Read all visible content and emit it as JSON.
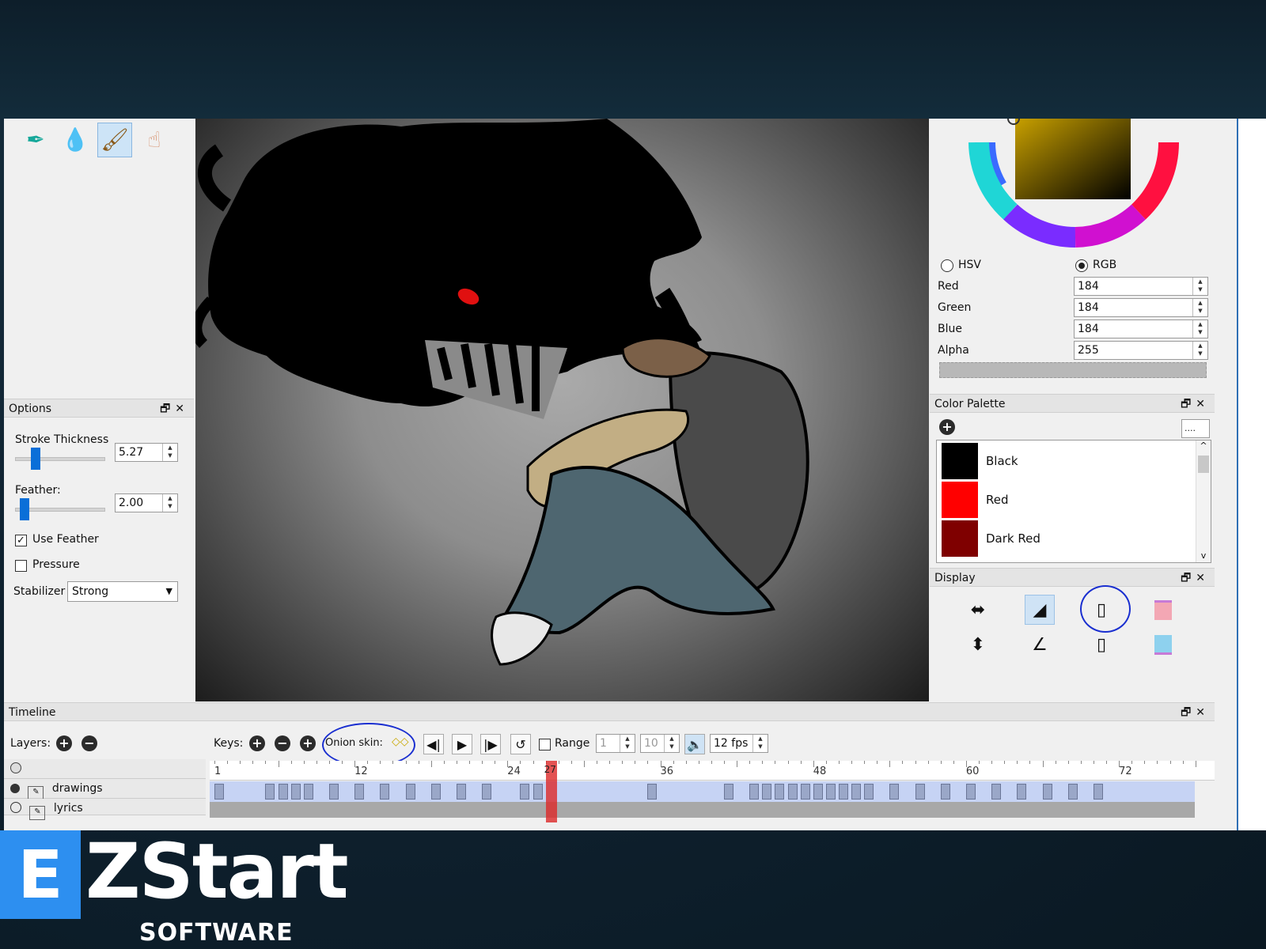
{
  "options": {
    "title": "Options",
    "stroke_label": "Stroke Thickness",
    "stroke_value": "5.27",
    "stroke_level": 0.18,
    "feather_label": "Feather:",
    "feather_value": "2.00",
    "feather_level": 0.05,
    "use_feather_label": "Use Feather",
    "use_feather_checked": true,
    "pressure_label": "Pressure",
    "pressure_checked": false,
    "stabilizer_label": "Stabilizer",
    "stabilizer_value": "Strong"
  },
  "color": {
    "hsv_label": "HSV",
    "rgb_label": "RGB",
    "mode": "RGB",
    "red_label": "Red",
    "red": "184",
    "green_label": "Green",
    "green": "184",
    "blue_label": "Blue",
    "blue": "184",
    "alpha_label": "Alpha",
    "alpha": "255",
    "preview": "#b8b8b8"
  },
  "palette": {
    "title": "Color Palette",
    "menu_label": "....",
    "items": [
      {
        "name": "Black",
        "color": "#000000"
      },
      {
        "name": "Red",
        "color": "#ff0000"
      },
      {
        "name": "Dark Red",
        "color": "#7f0000"
      }
    ]
  },
  "display": {
    "title": "Display"
  },
  "timeline": {
    "title": "Timeline",
    "layers_label": "Layers:",
    "keys_label": "Keys:",
    "onion_label": "Onion skin:",
    "range_label": "Range",
    "range_start": "1",
    "range_end": "10",
    "fps": "12 fps",
    "current_frame": "27",
    "ruler_labels": [
      "1",
      "12",
      "24",
      "36",
      "48",
      "60",
      "72"
    ],
    "layers": [
      {
        "name": "drawings"
      },
      {
        "name": "lyrics"
      }
    ]
  },
  "brand": {
    "letter": "E",
    "name": "ZStart",
    "sub": "SOFTWARE",
    "accent": "#2d8ff0"
  },
  "icons": [
    "pen-icon",
    "eyedropper-icon",
    "brush-icon",
    "hand-icon",
    "add-icon",
    "remove-icon",
    "duplicate-icon",
    "play-icon",
    "previous-frame-icon",
    "next-frame-icon",
    "loop-icon",
    "sound-icon"
  ]
}
